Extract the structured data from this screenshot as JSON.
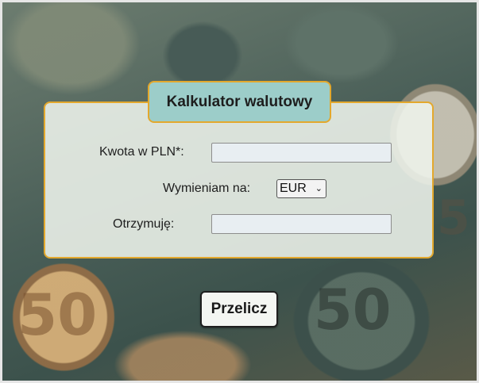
{
  "calculator": {
    "title": "Kalkulator walutowy",
    "amount_label": "Kwota w PLN*:",
    "amount_value": "",
    "currency_label": "Wymieniam na:",
    "currency_selected": "EUR",
    "result_label": "Otrzymuję:",
    "result_value": "",
    "submit_label": "Przelicz"
  },
  "background": {
    "coin_marks": [
      "50",
      "50",
      "5"
    ]
  }
}
